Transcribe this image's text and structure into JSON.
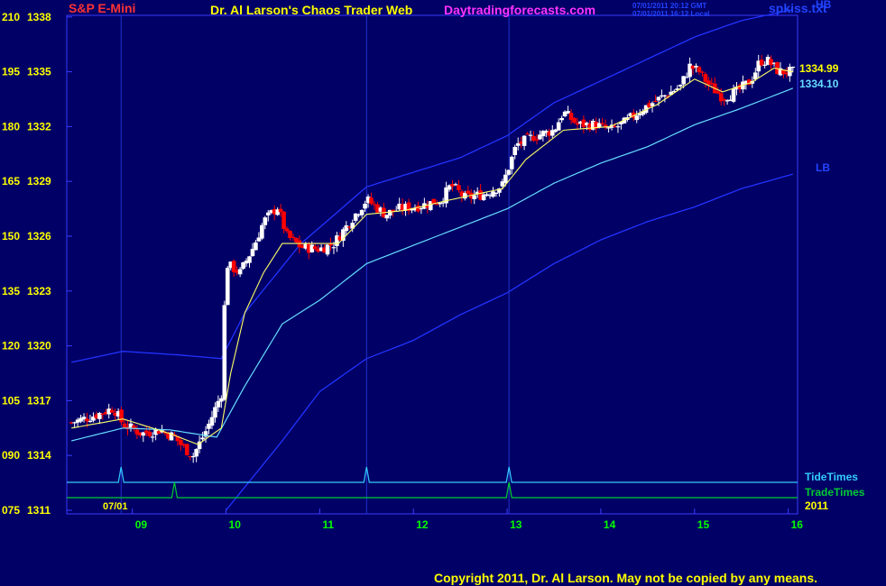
{
  "header": {
    "symbol": "S&P E-Mini",
    "title": "Dr. Al Larson's Chaos Trader Web",
    "site": "Daytradingforecasts.com",
    "timestamp_gmt": "07/01/2011 20:12 GMT",
    "timestamp_local": "07/01/2011 16:12 Local",
    "file": "spkiss.txt"
  },
  "colors": {
    "background": "#000066",
    "plot_border": "#3A3AFF",
    "axis_text": "#FFFF00",
    "symbol_text": "#FF3333",
    "site_text": "#FF33FF",
    "time_text": "#00FF00",
    "up_candle": "#FFFFFF",
    "down_candle": "#FF0000",
    "fast_ma": "#FFFF66",
    "slow_ma": "#66DDFF",
    "band": "#2233FF",
    "tide": "#33CCFF",
    "trade": "#00CC33",
    "copyright": "#FFFF00"
  },
  "chart_data": {
    "type": "candlestick",
    "ylim": [
      1311,
      1338
    ],
    "y_ticks": [
      {
        "count": "075",
        "price": "1311",
        "value": 1311
      },
      {
        "count": "090",
        "price": "1314",
        "value": 1314
      },
      {
        "count": "105",
        "price": "1317",
        "value": 1317
      },
      {
        "count": "120",
        "price": "1320",
        "value": 1320
      },
      {
        "count": "135",
        "price": "1323",
        "value": 1323
      },
      {
        "count": "150",
        "price": "1326",
        "value": 1326
      },
      {
        "count": "165",
        "price": "1329",
        "value": 1329
      },
      {
        "count": "180",
        "price": "1332",
        "value": 1332
      },
      {
        "count": "195",
        "price": "1335",
        "value": 1335
      },
      {
        "count": "210",
        "price": "1338",
        "value": 1338
      }
    ],
    "xlim": [
      8.3,
      16.1
    ],
    "x_ticks": [
      {
        "label": "09",
        "hour": 9
      },
      {
        "label": "10",
        "hour": 10
      },
      {
        "label": "11",
        "hour": 11
      },
      {
        "label": "12",
        "hour": 12
      },
      {
        "label": "13",
        "hour": 13
      },
      {
        "label": "14",
        "hour": 14
      },
      {
        "label": "15",
        "hour": 15
      },
      {
        "label": "16",
        "hour": 16
      }
    ],
    "date_label": "07/01",
    "year_label": "2011",
    "vertical_markers": [
      8.88,
      11.5,
      13.02
    ],
    "price_anchors": [
      [
        8.35,
        1315.8
      ],
      [
        8.6,
        1316.2
      ],
      [
        8.8,
        1316.6
      ],
      [
        8.9,
        1315.7
      ],
      [
        9.1,
        1315.2
      ],
      [
        9.3,
        1315.4
      ],
      [
        9.45,
        1315.0
      ],
      [
        9.55,
        1314.4
      ],
      [
        9.65,
        1314.0
      ],
      [
        9.8,
        1315.5
      ],
      [
        9.95,
        1317.4
      ],
      [
        10.0,
        1324.5
      ],
      [
        10.15,
        1324.0
      ],
      [
        10.3,
        1325.5
      ],
      [
        10.4,
        1326.8
      ],
      [
        10.55,
        1327.6
      ],
      [
        10.65,
        1326.0
      ],
      [
        10.8,
        1325.4
      ],
      [
        11.0,
        1325.3
      ],
      [
        11.15,
        1325.6
      ],
      [
        11.35,
        1327.0
      ],
      [
        11.5,
        1328.0
      ],
      [
        11.7,
        1327.2
      ],
      [
        11.85,
        1327.5
      ],
      [
        12.1,
        1327.7
      ],
      [
        12.3,
        1328.0
      ],
      [
        12.4,
        1328.8
      ],
      [
        12.55,
        1328.1
      ],
      [
        12.75,
        1328.3
      ],
      [
        12.95,
        1328.8
      ],
      [
        13.1,
        1331.0
      ],
      [
        13.3,
        1331.5
      ],
      [
        13.5,
        1331.8
      ],
      [
        13.6,
        1332.8
      ],
      [
        13.75,
        1332.1
      ],
      [
        13.95,
        1332.1
      ],
      [
        14.1,
        1331.8
      ],
      [
        14.25,
        1332.2
      ],
      [
        14.45,
        1333.0
      ],
      [
        14.65,
        1333.6
      ],
      [
        14.85,
        1334.2
      ],
      [
        14.95,
        1335.3
      ],
      [
        15.05,
        1335.0
      ],
      [
        15.15,
        1334.3
      ],
      [
        15.3,
        1333.6
      ],
      [
        15.45,
        1333.9
      ],
      [
        15.6,
        1334.5
      ],
      [
        15.7,
        1335.6
      ],
      [
        15.78,
        1335.6
      ],
      [
        15.9,
        1335.0
      ],
      [
        16.0,
        1335.0
      ],
      [
        16.05,
        1334.99
      ]
    ],
    "fast_ma_anchors": [
      [
        8.35,
        1315.5
      ],
      [
        8.9,
        1316.0
      ],
      [
        9.4,
        1315.2
      ],
      [
        9.7,
        1314.6
      ],
      [
        9.95,
        1315.5
      ],
      [
        10.05,
        1318.5
      ],
      [
        10.2,
        1321.8
      ],
      [
        10.4,
        1324.0
      ],
      [
        10.6,
        1325.6
      ],
      [
        10.9,
        1325.6
      ],
      [
        11.2,
        1325.6
      ],
      [
        11.5,
        1327.2
      ],
      [
        11.9,
        1327.4
      ],
      [
        12.4,
        1328.0
      ],
      [
        12.95,
        1328.6
      ],
      [
        13.2,
        1330.2
      ],
      [
        13.6,
        1331.8
      ],
      [
        14.1,
        1332.0
      ],
      [
        14.6,
        1333.2
      ],
      [
        15.0,
        1334.6
      ],
      [
        15.3,
        1333.9
      ],
      [
        15.6,
        1334.4
      ],
      [
        15.85,
        1335.2
      ],
      [
        16.05,
        1334.99
      ]
    ],
    "slow_ma_anchors": [
      [
        8.35,
        1314.8
      ],
      [
        8.9,
        1315.5
      ],
      [
        9.4,
        1315.4
      ],
      [
        9.9,
        1315.0
      ],
      [
        10.2,
        1317.8
      ],
      [
        10.6,
        1321.2
      ],
      [
        11.0,
        1322.5
      ],
      [
        11.5,
        1324.5
      ],
      [
        12.0,
        1325.5
      ],
      [
        12.5,
        1326.5
      ],
      [
        13.0,
        1327.5
      ],
      [
        13.5,
        1328.9
      ],
      [
        14.0,
        1330.0
      ],
      [
        14.5,
        1330.9
      ],
      [
        15.0,
        1332.1
      ],
      [
        15.5,
        1333.0
      ],
      [
        16.05,
        1334.1
      ]
    ],
    "upper_band_anchors": [
      [
        8.35,
        1319.1
      ],
      [
        8.9,
        1319.7
      ],
      [
        9.5,
        1319.5
      ],
      [
        9.95,
        1319.3
      ],
      [
        10.2,
        1321.8
      ],
      [
        10.8,
        1325.6
      ],
      [
        11.5,
        1328.7
      ],
      [
        12.5,
        1330.3
      ],
      [
        13.0,
        1331.5
      ],
      [
        13.5,
        1333.3
      ],
      [
        14.0,
        1334.5
      ],
      [
        14.5,
        1335.7
      ],
      [
        15.0,
        1336.9
      ],
      [
        15.5,
        1337.8
      ],
      [
        16.05,
        1338.4
      ]
    ],
    "lower_band_anchors": [
      [
        10.0,
        1311.0
      ],
      [
        10.6,
        1314.8
      ],
      [
        11.0,
        1317.5
      ],
      [
        11.5,
        1319.3
      ],
      [
        12.0,
        1320.3
      ],
      [
        12.5,
        1321.7
      ],
      [
        13.0,
        1322.9
      ],
      [
        13.5,
        1324.5
      ],
      [
        14.0,
        1325.8
      ],
      [
        14.5,
        1326.8
      ],
      [
        15.0,
        1327.6
      ],
      [
        15.5,
        1328.6
      ],
      [
        16.05,
        1329.4
      ]
    ],
    "tide_spikes": [
      8.88,
      11.5,
      13.02
    ],
    "trade_spikes": [
      9.45,
      13.02
    ],
    "last_price": "1334.99",
    "ma_value": "1334.10",
    "band_labels": {
      "upper": "HB",
      "lower": "LB"
    },
    "line_labels": {
      "tide": "TideTimes",
      "trade": "TradeTimes"
    }
  },
  "footer": {
    "copyright": "Copyright 2011, Dr. Al Larson. May not be copied by any means."
  }
}
